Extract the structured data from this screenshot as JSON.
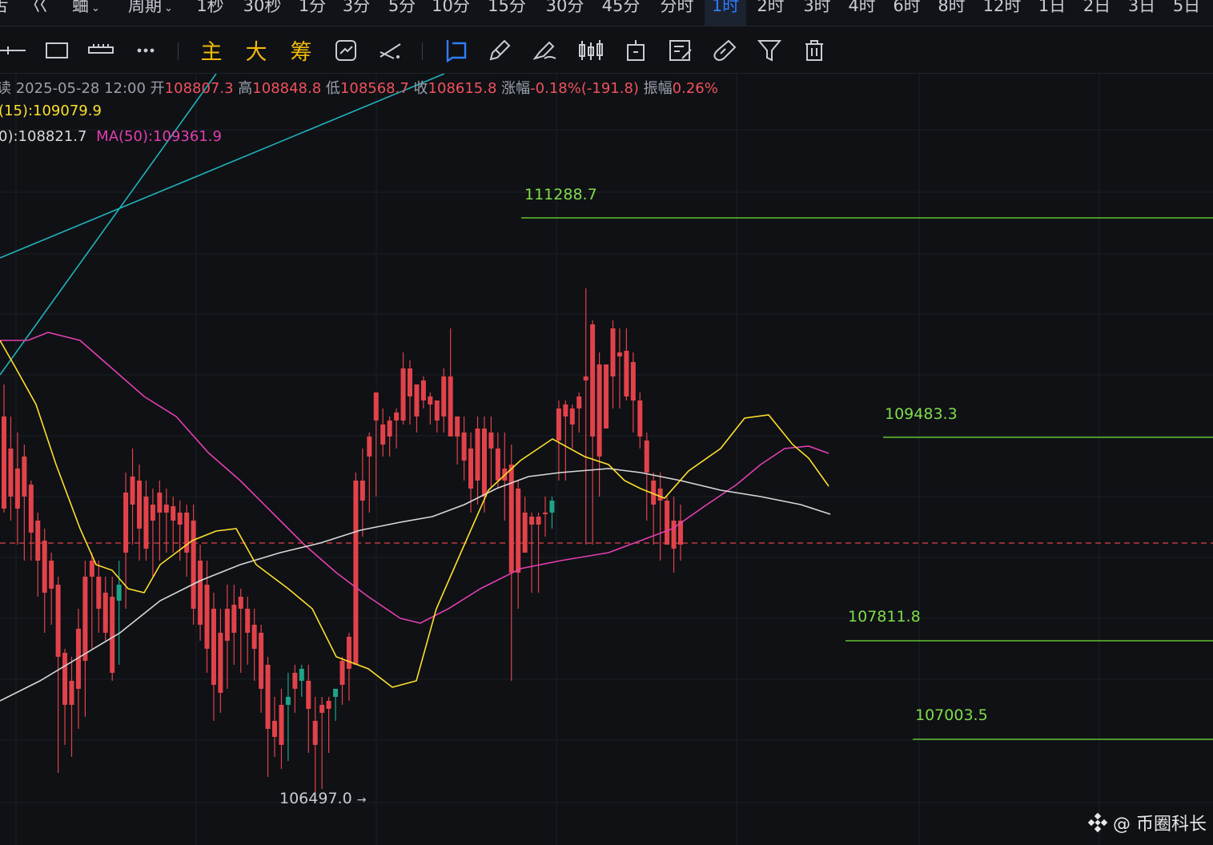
{
  "timeframes": [
    {
      "label": "舌"
    },
    {
      "label": "巜"
    },
    {
      "label": "蛐",
      "dropdown": true
    },
    {
      "label": "周期",
      "dropdown": true
    },
    {
      "label": "1秒"
    },
    {
      "label": "30秒"
    },
    {
      "label": "1分"
    },
    {
      "label": "3分"
    },
    {
      "label": "5分"
    },
    {
      "label": "10分"
    },
    {
      "label": "15分"
    },
    {
      "label": "30分"
    },
    {
      "label": "45分"
    },
    {
      "label": "分时"
    },
    {
      "label": "1时",
      "active": true
    },
    {
      "label": "2时"
    },
    {
      "label": "3时"
    },
    {
      "label": "4时"
    },
    {
      "label": "6时"
    },
    {
      "label": "8时"
    },
    {
      "label": "12时"
    },
    {
      "label": "1日"
    },
    {
      "label": "2日"
    },
    {
      "label": "3日"
    },
    {
      "label": "5日"
    }
  ],
  "toolbar": {
    "text_tools": [
      "主",
      "大",
      "筹"
    ],
    "icons": [
      "crosshair-line-icon",
      "rectangle-icon",
      "ruler-dots-icon",
      "more-icon",
      "image-transform-icon",
      "trend-tool-icon",
      "bookmark-icon",
      "pencil-icon",
      "brush-icon",
      "candles-icon",
      "text-box-icon",
      "note-icon",
      "magnet-icon",
      "filter-icon",
      "trash-icon"
    ]
  },
  "ohlc": {
    "prefix": "读",
    "datetime": "2025-05-28 12:00",
    "open_label": "开",
    "open": "108807.3",
    "high_label": "高",
    "high": "108848.8",
    "low_label": "低",
    "low": "108568.7",
    "close_label": "收",
    "close": "108615.8",
    "change_label": "涨幅",
    "change": "-0.18%(-191.8)",
    "amp_label": "振幅",
    "amp": "0.26%"
  },
  "ma_line1": "(15):109079.9",
  "ma_line2_a": "0):108821.7",
  "ma_line2_b": "MA(50):109361.9",
  "levels": {
    "l1": "111288.7",
    "l2": "109483.3",
    "l3": "107811.8",
    "l4": "107003.5"
  },
  "low_marker": "106497.0",
  "watermark": "@ 币圈科长",
  "colors": {
    "up": "#1fa387",
    "down": "#e2424a",
    "ma_fast": "#ffdf2c",
    "ma_mid": "#d9d9d9",
    "ma_slow": "#e23fb0",
    "level": "#63c12f",
    "trend": "#21b3bb"
  }
}
